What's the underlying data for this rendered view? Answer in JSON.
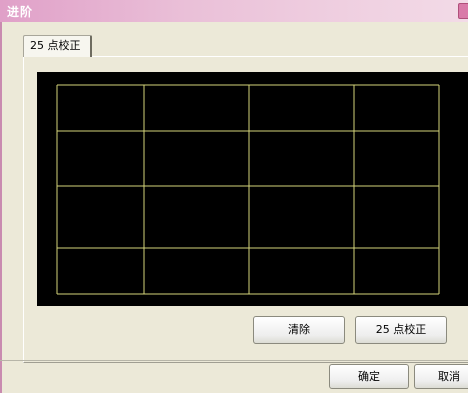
{
  "window": {
    "title": "进阶",
    "accent_color": "#e0a0c8"
  },
  "tabs": [
    {
      "label": "25 点校正"
    }
  ],
  "calibration_area": {
    "background": "#000000",
    "grid_color": "#d4d47a",
    "columns": 4,
    "rows": 4
  },
  "buttons": {
    "clear": "清除",
    "calibrate": "25 点校正",
    "ok": "确定",
    "cancel": "取消"
  }
}
